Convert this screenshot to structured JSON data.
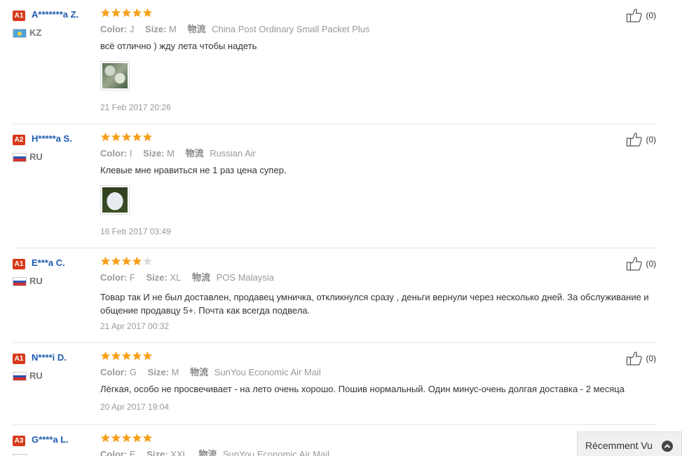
{
  "reviews": [
    {
      "level": "A1",
      "name": "A*******a Z.",
      "country": "KZ",
      "flag": "kz",
      "stars": 5,
      "color_label": "Color:",
      "color": "J",
      "size_label": "Size:",
      "size": "M",
      "shipping_label": "物流",
      "shipping": "China Post Ordinary Small Packet Plus",
      "text": "всё отлично ) жду лета чтобы надеть",
      "photo": "floral",
      "date": "21 Feb 2017 20:26",
      "likes": "(0)"
    },
    {
      "level": "A2",
      "name": "H*****a S.",
      "country": "RU",
      "flag": "ru",
      "stars": 5,
      "color_label": "Color:",
      "color": "I",
      "size_label": "Size:",
      "size": "M",
      "shipping_label": "物流",
      "shipping": "Russian Air",
      "text": "Клевые мне нравиться не 1 раз цена супер.",
      "photo": "white",
      "date": "16 Feb 2017 03:49",
      "likes": "(0)"
    },
    {
      "level": "A1",
      "name": "E***a C.",
      "country": "RU",
      "flag": "ru",
      "stars": 4,
      "color_label": "Color:",
      "color": "F",
      "size_label": "Size:",
      "size": "XL",
      "shipping_label": "物流",
      "shipping": "POS Malaysia",
      "text": "Товар так И не был доставлен, продавец умничка, откликнулся сразу , деньги вернули через несколько дней. За обслуживание и общение продавцу 5+. Почта как всегда подвела.",
      "date": "21 Apr 2017 00:32",
      "likes": "(0)"
    },
    {
      "level": "A1",
      "name": "N****i D.",
      "country": "RU",
      "flag": "ru",
      "stars": 5,
      "color_label": "Color:",
      "color": "G",
      "size_label": "Size:",
      "size": "M",
      "shipping_label": "物流",
      "shipping": "SunYou Economic Air Mail",
      "text": "Лёгкая, особо не просвечивает - на лето очень хорошо. Пошив нормальный. Один минус-очень долгая доставка - 2 месяца",
      "date": "20 Apr 2017 19:04",
      "likes": "(0)"
    },
    {
      "level": "A3",
      "name": "G****a L.",
      "country": "",
      "flag": "ru",
      "stars": 5,
      "color_label": "Color:",
      "color": "E",
      "size_label": "Size:",
      "size": "XXL",
      "shipping_label": "物流",
      "shipping": "SunYou Economic Air Mail",
      "text": "",
      "date": "",
      "likes": ""
    }
  ],
  "recently_viewed": {
    "label": "Récemment Vu",
    "icon": "chevron-up-icon"
  },
  "colors": {
    "star": "#f7a01c",
    "star_empty": "#dddddd",
    "badge": "#d63a1a",
    "name": "#1e5bb0"
  }
}
